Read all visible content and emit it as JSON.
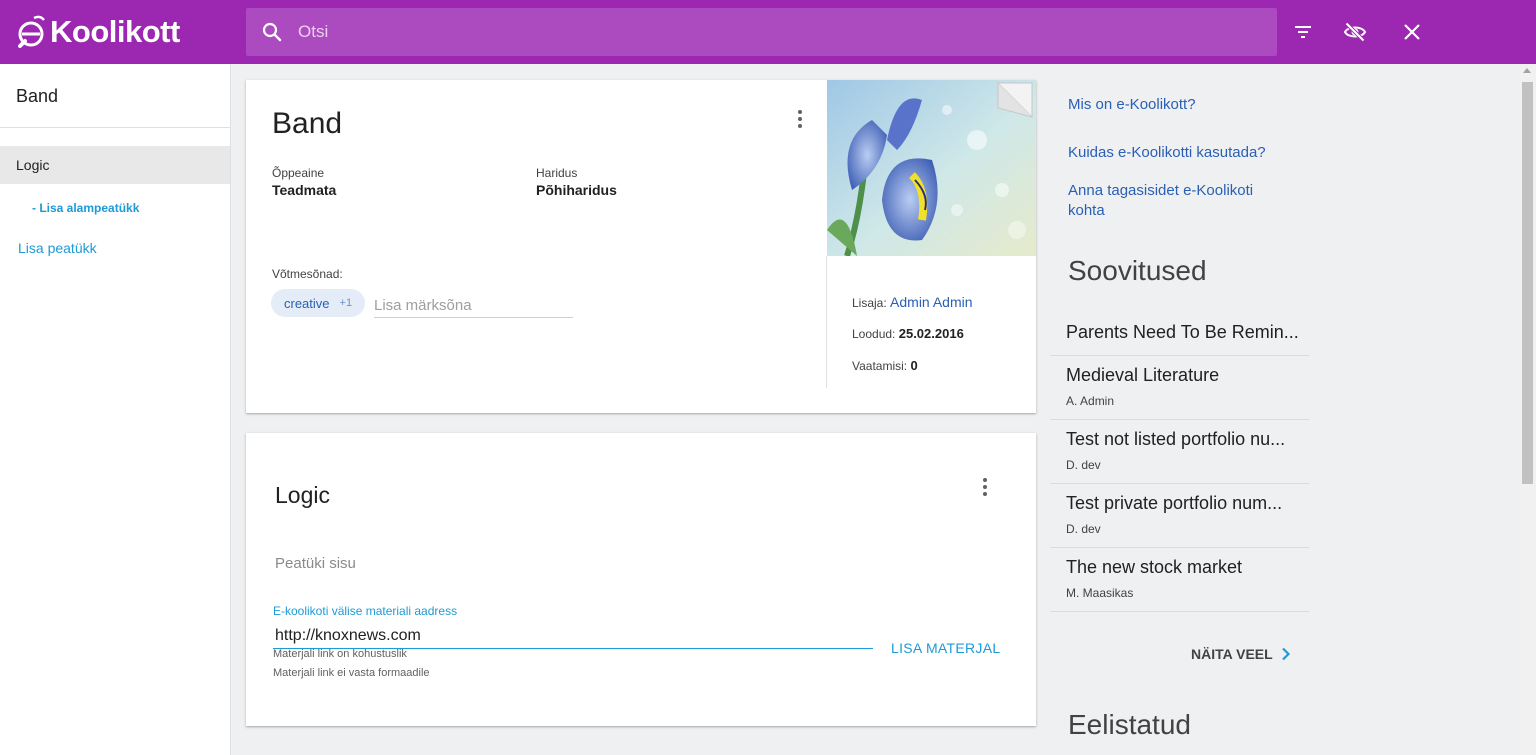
{
  "app": {
    "logo_text": "Koolikott",
    "brand_color": "#9c27b0"
  },
  "search": {
    "placeholder": "Otsi"
  },
  "top_actions": [
    "filter-icon",
    "visibility-off-icon",
    "close-icon"
  ],
  "sidebar": {
    "title": "Band",
    "items": [
      {
        "label": "Logic"
      }
    ],
    "add_subchapter": "- Lisa alampeatükk",
    "add_chapter": "Lisa peatükk"
  },
  "portfolio": {
    "title": "Band",
    "subject_label": "Õppeaine",
    "subject_value": "Teadmata",
    "education_label": "Haridus",
    "education_value": "Põhiharidus",
    "keywords_label": "Võtmesõnad:",
    "keyword_chip": "creative",
    "keyword_more": "+1",
    "keyword_placeholder": "Lisa märksõna",
    "creator_label": "Lisaja:",
    "creator_name": "Admin Admin",
    "created_label": "Loodud:",
    "created_value": "25.02.2016",
    "views_label": "Vaatamisi:",
    "views_value": "0"
  },
  "chapter": {
    "title": "Logic",
    "content_placeholder": "Peatüki sisu",
    "field_label": "E-koolikoti välise materiali aadress",
    "field_value": "http://knoxnews.com",
    "error_required": "Materjali link on kohustuslik",
    "error_format": "Materjali link ei vasta formaadile",
    "add_button": "LISA MATERJAL"
  },
  "help_links": [
    "Mis on e-Koolikott?",
    "Kuidas e-Koolikotti kasutada?",
    "Anna tagasisidet e-Koolikoti kohta"
  ],
  "recommendations": {
    "title": "Soovitused",
    "items": [
      {
        "title": "Parents Need To Be Remin...",
        "author": ""
      },
      {
        "title": "Medieval Literature",
        "author": "A. Admin"
      },
      {
        "title": "Test not listed portfolio nu...",
        "author": "D. dev"
      },
      {
        "title": "Test private portfolio num...",
        "author": "D. dev"
      },
      {
        "title": "The new stock market",
        "author": "M. Maasikas"
      }
    ],
    "more_label": "NÄITA VEEL"
  },
  "favorites": {
    "title": "Eelistatud"
  }
}
